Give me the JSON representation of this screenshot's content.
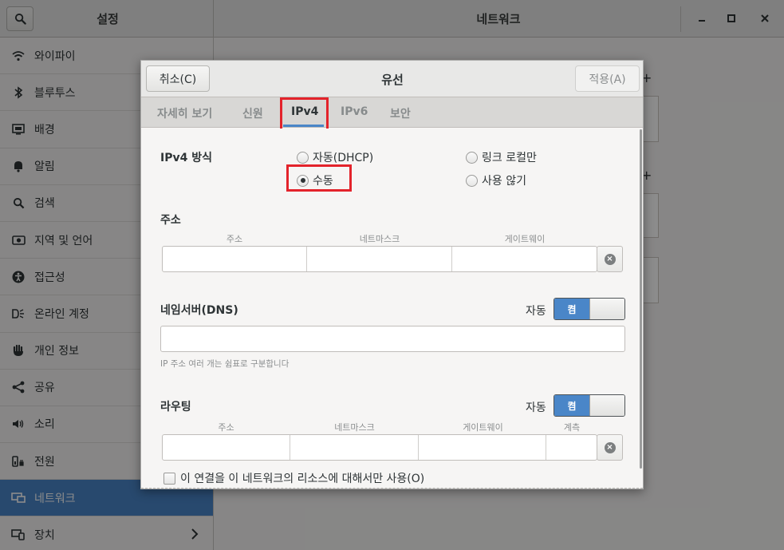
{
  "settings_window": {
    "sidebar_title": "설정",
    "panel_title": "네트워크",
    "controls": {
      "minimize": "_",
      "maximize": "□",
      "close": "×"
    }
  },
  "sidebar": {
    "items": [
      {
        "label": "와이파이",
        "icon": "wifi-icon"
      },
      {
        "label": "블루투스",
        "icon": "bluetooth-icon"
      },
      {
        "label": "배경",
        "icon": "background-icon"
      },
      {
        "label": "알림",
        "icon": "bell-icon"
      },
      {
        "label": "검색",
        "icon": "search-icon"
      },
      {
        "label": "지역 및 언어",
        "icon": "camera-icon"
      },
      {
        "label": "접근성",
        "icon": "accessibility-icon"
      },
      {
        "label": "온라인 계정",
        "icon": "online-accounts-icon"
      },
      {
        "label": "개인 정보",
        "icon": "hand-icon"
      },
      {
        "label": "공유",
        "icon": "share-icon"
      },
      {
        "label": "소리",
        "icon": "speaker-icon"
      },
      {
        "label": "전원",
        "icon": "power-icon"
      },
      {
        "label": "네트워크",
        "icon": "network-icon",
        "selected": true
      },
      {
        "label": "장치",
        "icon": "devices-icon",
        "has_chevron": true
      }
    ]
  },
  "dialog": {
    "cancel_label": "취소(C)",
    "title": "유선",
    "apply_label": "적용(A)",
    "tabs": [
      "자세히 보기",
      "신원",
      "IPv4",
      "IPv6",
      "보안"
    ],
    "active_tab": "IPv4",
    "ipv4_method": {
      "label": "IPv4 방식",
      "options": [
        "자동(DHCP)",
        "링크 로컬만",
        "수동",
        "사용 않기"
      ],
      "selected": "수동"
    },
    "address": {
      "title": "주소",
      "columns": [
        "주소",
        "네트마스크",
        "게이트웨이"
      ]
    },
    "dns": {
      "title": "네임서버(DNS)",
      "auto_label": "자동",
      "switch_label": "켬",
      "hint": "IP 주소 여러 개는 쉼표로 구분합니다"
    },
    "routing": {
      "title": "라우팅",
      "auto_label": "자동",
      "switch_label": "켬",
      "columns": [
        "주소",
        "네트마스크",
        "게이트웨이",
        "계측"
      ]
    },
    "restrict_checkbox": "이 연결을 이 네트워크의 리소스에 대해서만 사용(O)"
  }
}
